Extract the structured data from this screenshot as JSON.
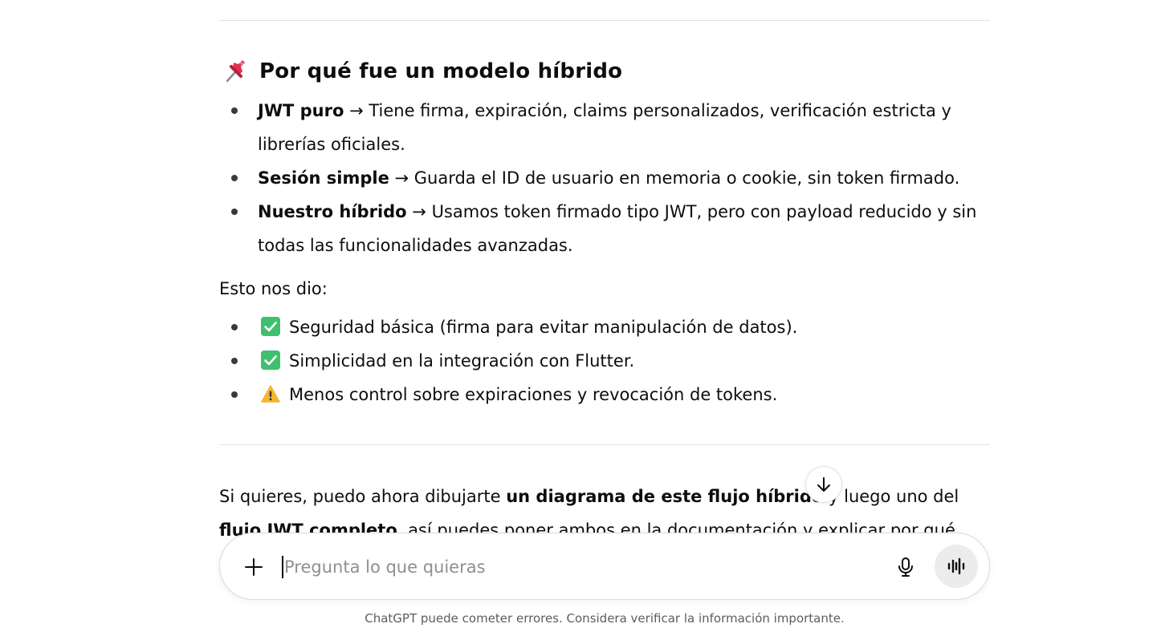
{
  "section": {
    "heading_emoji": "pushpin",
    "heading": "Por qué fue un modelo híbrido",
    "models": [
      {
        "term": "JWT puro",
        "arrow": " → ",
        "desc": "Tiene firma, expiración, claims personalizados, verificación estricta y librerías oficiales."
      },
      {
        "term": "Sesión simple",
        "arrow": " → ",
        "desc": "Guarda el ID de usuario en memoria o cookie, sin token firmado."
      },
      {
        "term": "Nuestro híbrido",
        "arrow": " → ",
        "desc": "Usamos token firmado tipo JWT, pero con payload reducido y sin todas las funcionalidades avanzadas."
      }
    ],
    "result_intro": "Esto nos dio:",
    "results": [
      {
        "icon": "check-mark-icon",
        "text": "Seguridad básica (firma para evitar manipulación de datos)."
      },
      {
        "icon": "check-mark-icon",
        "text": "Simplicidad en la integración con Flutter."
      },
      {
        "icon": "warning-icon",
        "text": "Menos control sobre expiraciones y revocación de tokens."
      }
    ]
  },
  "followup": {
    "part1": "Si quieres, puedo ahora dibujarte ",
    "bold1": "un diagrama de este flujo híbrido",
    "part2": " y luego uno del ",
    "bold2": "flujo JWT completo",
    "part3": ", así puedes poner ambos en la documentación y explicar por qué"
  },
  "composer": {
    "placeholder": "Pregunta lo que quieras",
    "value": ""
  },
  "footer": {
    "disclaimer": "ChatGPT puede cometer errores. Considera verificar la información importante."
  },
  "colors": {
    "check_green": "#3fbf6f",
    "warning_yellow": "#f5b52e",
    "pin_red": "#e0334f"
  }
}
